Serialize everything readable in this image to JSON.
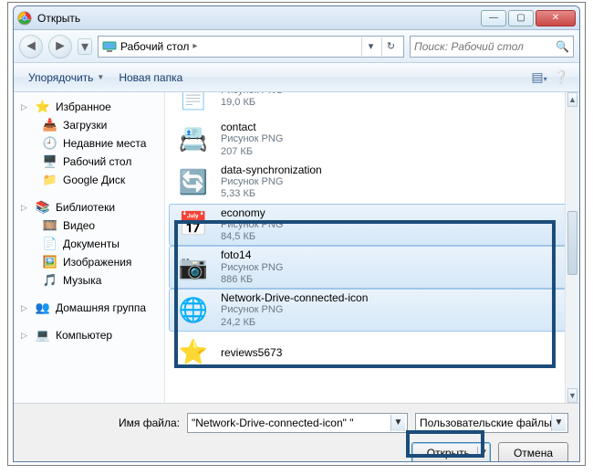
{
  "title": "Открыть",
  "address": {
    "location": "Рабочий стол"
  },
  "search": {
    "placeholder": "Поиск: Рабочий стол"
  },
  "toolbar": {
    "organize": "Упорядочить",
    "newfolder": "Новая папка"
  },
  "sidebar": {
    "favorites": {
      "label": "Избранное",
      "items": [
        "Загрузки",
        "Недавние места",
        "Рабочий стол",
        "Google Диск"
      ]
    },
    "libraries": {
      "label": "Библиотеки",
      "items": [
        "Видео",
        "Документы",
        "Изображения",
        "Музыка"
      ]
    },
    "homegroup": "Домашняя группа",
    "computer": "Компьютер"
  },
  "files": [
    {
      "name": "",
      "type": "Рисунок PNG",
      "size": "19,0 КБ",
      "thumb": "📄",
      "selected": false,
      "partial_top": true
    },
    {
      "name": "contact",
      "type": "Рисунок PNG",
      "size": "207 КБ",
      "thumb": "📇",
      "selected": false
    },
    {
      "name": "data-synchronization",
      "type": "Рисунок PNG",
      "size": "5,33 КБ",
      "thumb": "🔄",
      "selected": false
    },
    {
      "name": "economy",
      "type": "Рисунок PNG",
      "size": "84,5 КБ",
      "thumb": "📅",
      "selected": true
    },
    {
      "name": "foto14",
      "type": "Рисунок PNG",
      "size": "886 КБ",
      "thumb": "📷",
      "selected": true
    },
    {
      "name": "Network-Drive-connected-icon",
      "type": "Рисунок PNG",
      "size": "24,2 КБ",
      "thumb": "🌐",
      "selected": true
    },
    {
      "name": "reviews5673",
      "type": "",
      "size": "",
      "thumb": "⭐",
      "selected": false,
      "partial_bottom": true
    }
  ],
  "footer": {
    "filename_label": "Имя файла:",
    "filename_value": "\"Network-Drive-connected-icon\" \"",
    "filter": "Пользовательские файлы",
    "open": "Открыть",
    "cancel": "Отмена"
  }
}
